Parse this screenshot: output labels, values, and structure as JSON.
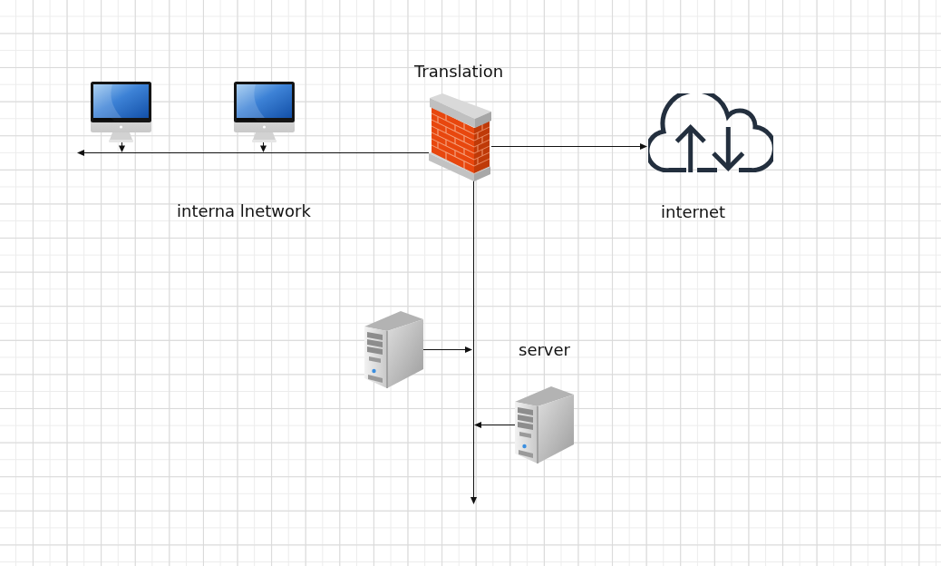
{
  "diagram": {
    "nodes": [
      {
        "kind": "monitor"
      },
      {
        "kind": "monitor"
      },
      {
        "kind": "firewall"
      },
      {
        "kind": "cloud"
      },
      {
        "kind": "server"
      },
      {
        "kind": "server"
      }
    ],
    "labels": [
      "Translation",
      "interna lnetwork",
      "internet",
      "server"
    ]
  }
}
